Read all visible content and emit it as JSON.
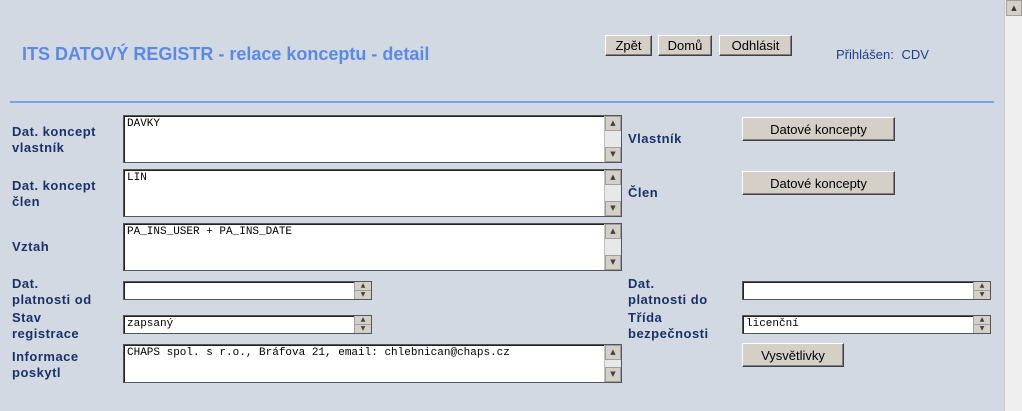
{
  "header": {
    "title": "ITS DATOVÝ REGISTR - relace konceptu - detail",
    "buttons": {
      "back": "Zpět",
      "home": "Domů",
      "logout": "Odhlásit"
    },
    "login_label": "Přihlášen:",
    "login_user": "CDV"
  },
  "form": {
    "owner_concept": {
      "label_1": "Dat. koncept",
      "label_2": "vlastník",
      "value": "DAVKY"
    },
    "member_concept": {
      "label_1": "Dat. koncept",
      "label_2": "člen",
      "value": "LIN"
    },
    "relation": {
      "label": "Vztah",
      "value": "PA_INS_USER + PA_INS_DATE"
    },
    "valid_from": {
      "label_1": "Dat.",
      "label_2": "platnosti od",
      "value": ""
    },
    "valid_to": {
      "label_1": "Dat.",
      "label_2": "platnosti do",
      "value": ""
    },
    "state": {
      "label_1": "Stav",
      "label_2": "registrace",
      "value": "zapsaný"
    },
    "security": {
      "label_1": "Třída",
      "label_2": "bezpečnosti",
      "value": "licenční"
    },
    "provider": {
      "label_1": "Informace",
      "label_2": "poskytl",
      "value": "CHAPS spol. s r.o., Bráfova 21, email: chlebnican@chaps.cz"
    }
  },
  "right_panel": {
    "owner_label": "Vlastník",
    "member_label": "Člen",
    "owner_button": "Datové koncepty",
    "member_button": "Datové koncepty",
    "help_button": "Vysvětlivky"
  },
  "icons": {
    "up": "▲",
    "down": "▼"
  }
}
